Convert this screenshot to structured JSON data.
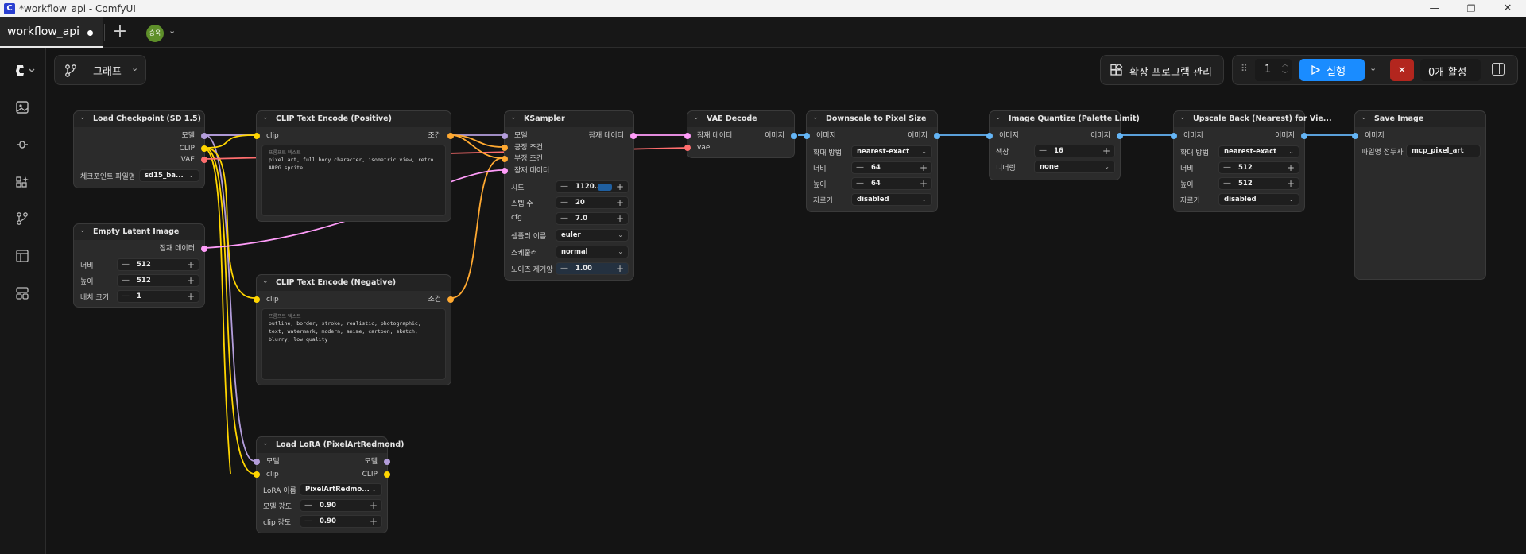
{
  "window": {
    "title": "*workflow_api - ComfyUI",
    "app_icon": "C",
    "minimize": "—",
    "maximize": "❐",
    "close": "✕"
  },
  "tabs": {
    "active_label": "workflow_api",
    "new_tab": "+",
    "avatar_text": "승욱"
  },
  "toolbar": {
    "graph_label": "그래프",
    "extensions_label": "확장 프로그램 관리",
    "queue_count": "1",
    "run_label": "실행",
    "active_label": "0개 활성"
  },
  "nodes": {
    "load_checkpoint": {
      "title": "Load Checkpoint (SD 1.5)",
      "outputs": [
        "모델",
        "CLIP",
        "VAE"
      ],
      "widget_label": "체크포인트 파일명",
      "widget_value": "sd15_ba..."
    },
    "empty_latent": {
      "title": "Empty Latent Image",
      "output": "잠재 데이터",
      "widgets": [
        {
          "label": "너비",
          "value": "512"
        },
        {
          "label": "높이",
          "value": "512"
        },
        {
          "label": "배치 크기",
          "value": "1"
        }
      ]
    },
    "clip_pos": {
      "title": "CLIP Text Encode (Positive)",
      "input": "clip",
      "output": "조건",
      "placeholder": "프롬프트 텍스트",
      "text": "pixel art, full body character, isometric view, retro ARPG sprite"
    },
    "clip_neg": {
      "title": "CLIP Text Encode (Negative)",
      "input": "clip",
      "output": "조건",
      "placeholder": "프롬프트 텍스트",
      "text": "outline, border, stroke, realistic, photographic, text, watermark, modern, anime, cartoon, sketch, blurry, low quality"
    },
    "ksampler": {
      "title": "KSampler",
      "inputs": [
        "모델",
        "긍정 조건",
        "부정 조건",
        "잠재 데이터"
      ],
      "output": "잠재 데이터",
      "widgets": [
        {
          "label": "시드",
          "value": "1120..."
        },
        {
          "label": "스텝 수",
          "value": "20"
        },
        {
          "label": "cfg",
          "value": "7.0"
        },
        {
          "label": "샘플러 이름",
          "value": "euler"
        },
        {
          "label": "스케줄러",
          "value": "normal"
        },
        {
          "label": "노이즈 제거양",
          "value": "1.00"
        }
      ]
    },
    "vae_decode": {
      "title": "VAE Decode",
      "inputs": [
        "잠재 데이터",
        "vae"
      ],
      "output": "이미지"
    },
    "downscale": {
      "title": "Downscale to Pixel Size",
      "input": "이미지",
      "output": "이미지",
      "widgets": [
        {
          "label": "확대 방법",
          "value": "nearest-exact"
        },
        {
          "label": "너비",
          "value": "64"
        },
        {
          "label": "높이",
          "value": "64"
        },
        {
          "label": "자르기",
          "value": "disabled"
        }
      ]
    },
    "quantize": {
      "title": "Image Quantize (Palette Limit)",
      "input": "이미지",
      "output": "이미지",
      "widgets": [
        {
          "label": "색상",
          "value": "16"
        },
        {
          "label": "디더링",
          "value": "none"
        }
      ]
    },
    "upscale": {
      "title": "Upscale Back (Nearest) for Vie...",
      "input": "이미지",
      "output": "이미지",
      "widgets": [
        {
          "label": "확대 방법",
          "value": "nearest-exact"
        },
        {
          "label": "너비",
          "value": "512"
        },
        {
          "label": "높이",
          "value": "512"
        },
        {
          "label": "자르기",
          "value": "disabled"
        }
      ]
    },
    "save_image": {
      "title": "Save Image",
      "input": "이미지",
      "widget_label": "파일명 접두사",
      "widget_value": "mcp_pixel_art"
    },
    "lora": {
      "title": "Load LoRA (PixelArtRedmond)",
      "inputs": [
        "모델",
        "clip"
      ],
      "outputs": [
        "모델",
        "CLIP"
      ],
      "widgets": [
        {
          "label": "LoRA 이름",
          "value": "PixelArtRedmo..."
        },
        {
          "label": "모델 강도",
          "value": "0.90"
        },
        {
          "label": "clip 강도",
          "value": "0.90"
        }
      ]
    }
  },
  "colors": {
    "model": "#b39ddb",
    "clip": "#ffd500",
    "vae": "#ff6e6e",
    "conditioning": "#ffa931",
    "latent": "#ff9cf9",
    "image": "#64b5f6",
    "run": "#1a8cff",
    "cancel": "#b3261e"
  }
}
